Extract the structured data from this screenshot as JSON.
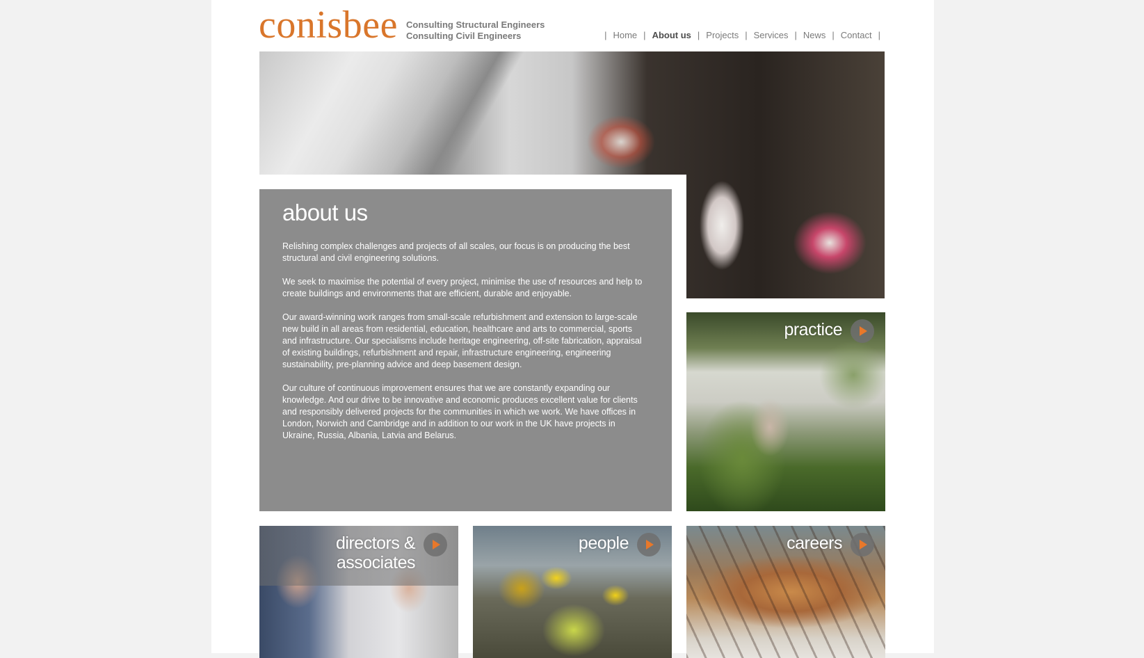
{
  "header": {
    "logo_text": "conisbee",
    "tagline": [
      "Consulting Structural Engineers",
      "Consulting Civil Engineers"
    ],
    "brand_color": "#d9762b"
  },
  "nav": {
    "items": [
      "Home",
      "About us",
      "Projects",
      "Services",
      "News",
      "Contact"
    ],
    "active": "About us"
  },
  "about": {
    "title": "about us",
    "paragraphs": [
      "Relishing complex challenges and projects of all scales, our focus is on producing the best structural and civil engineering solutions.",
      "We seek to maximise the potential of every project, minimise the use of resources and help to create buildings and environments that are efficient, durable and enjoyable.",
      "Our award-winning work ranges from small-scale refurbishment and extension to large-scale new build in all areas from residential, education, healthcare and arts to commercial, sports and infrastructure. Our specialisms include heritage engineering, off-site fabrication, appraisal of existing buildings, refurbishment and repair, infrastructure engineering, engineering sustainability, pre-planning advice and deep basement design.",
      "Our culture of continuous improvement ensures that we are constantly expanding our knowledge. And our drive to be innovative and economic produces excellent value for clients and responsibly delivered projects for the communities in which we work. We have offices in London, Norwich and Cambridge and in addition to our work in the UK have projects in Ukraine, Russia, Albania, Latvia and Belarus."
    ],
    "panel_color": "#8c8c8c"
  },
  "tiles": {
    "practice": "practice",
    "directors_line1": "directors &",
    "directors_line2": "associates",
    "people": "people",
    "careers": "careers",
    "arrow_icon": "play-arrow-icon",
    "arrow_color": "#e8782a"
  }
}
